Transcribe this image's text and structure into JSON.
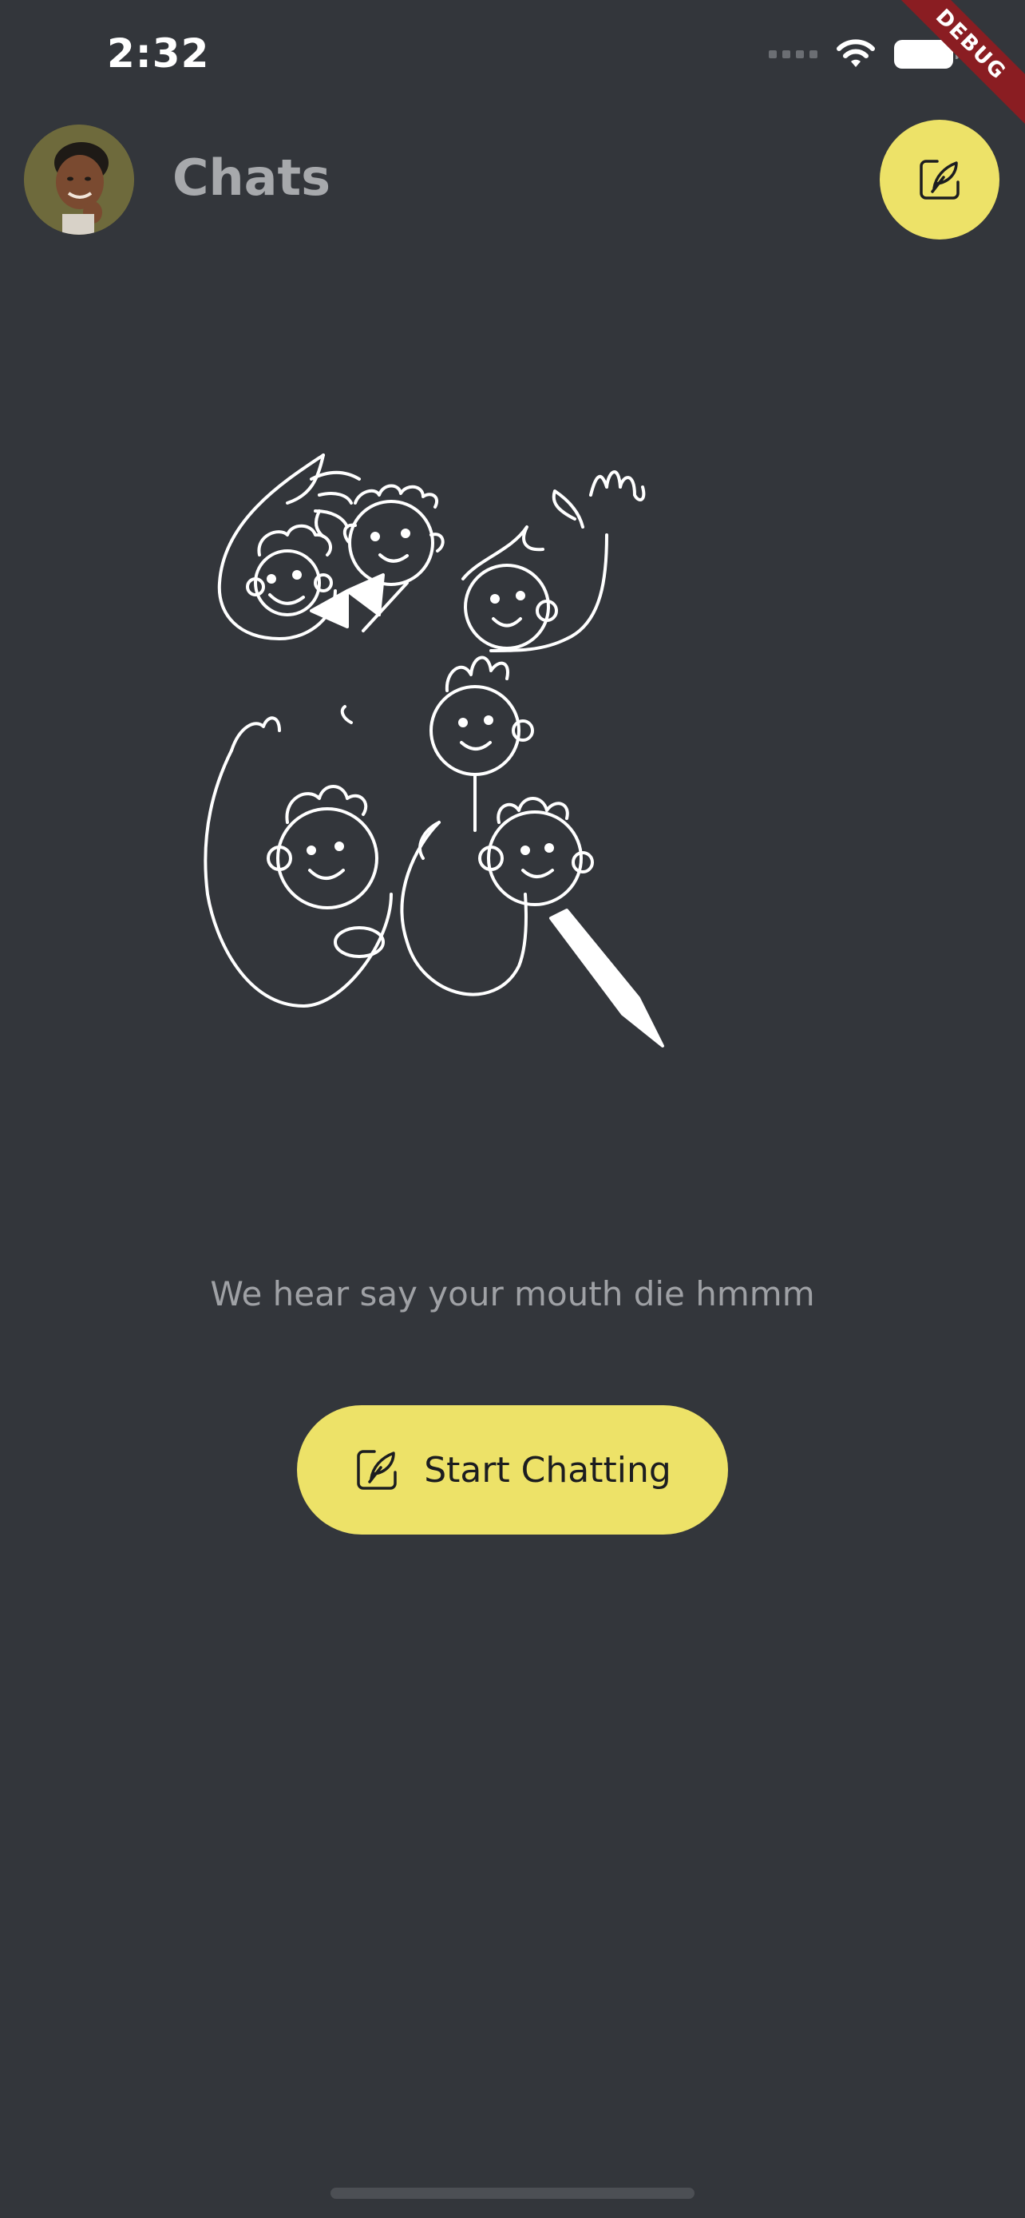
{
  "status_bar": {
    "time": "2:32"
  },
  "debug_banner": {
    "label": "DEBUG"
  },
  "header": {
    "title": "Chats",
    "compose_icon": "compose-feather-icon"
  },
  "empty_state": {
    "illustration": "group-of-people-doodle",
    "message": "We hear say your mouth die hmmm",
    "button_label": "Start Chatting",
    "button_icon": "compose-feather-icon"
  },
  "colors": {
    "background": "#33363b",
    "accent": "#ede268",
    "title": "#a7a9ac",
    "message": "#9fa1a5"
  }
}
